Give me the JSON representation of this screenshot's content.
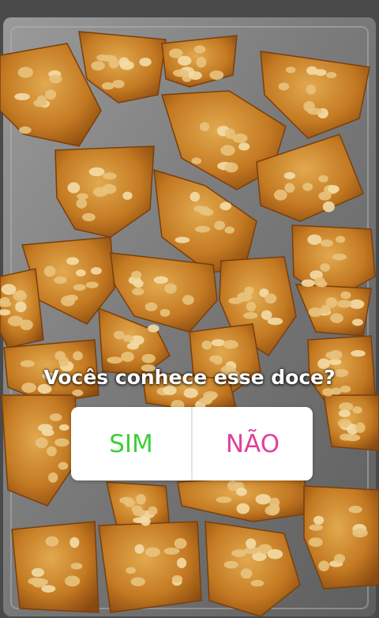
{
  "story": {
    "image": "peanut-brittle-on-tray",
    "poll": {
      "question": "Vocês conhece esse doce?",
      "options": [
        {
          "label": "SIM",
          "color": "#3ccf3a"
        },
        {
          "label": "NÃO",
          "color": "#e0419c"
        }
      ]
    }
  }
}
